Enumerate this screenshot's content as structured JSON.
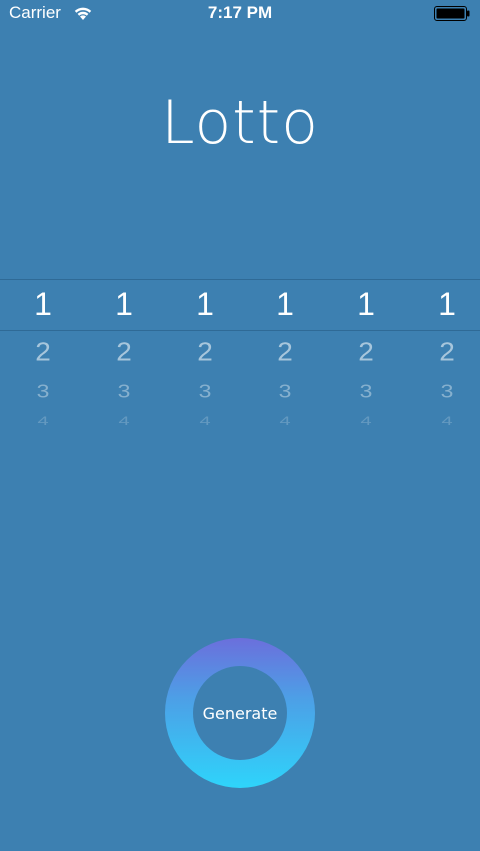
{
  "status_bar": {
    "carrier": "Carrier",
    "time": "7:17 PM",
    "wifi_icon": "wifi-icon",
    "battery_icon": "battery-icon"
  },
  "title": "Lotto",
  "picker": {
    "wheels": [
      {
        "values": [
          "1",
          "2",
          "3",
          "4"
        ]
      },
      {
        "values": [
          "1",
          "2",
          "3",
          "4"
        ]
      },
      {
        "values": [
          "1",
          "2",
          "3",
          "4"
        ]
      },
      {
        "values": [
          "1",
          "2",
          "3",
          "4"
        ]
      },
      {
        "values": [
          "1",
          "2",
          "3",
          "4"
        ]
      },
      {
        "values": [
          "1",
          "2",
          "3",
          "4"
        ]
      }
    ]
  },
  "generate_button": {
    "label": "Generate",
    "gradient_top": "#6b6fdc",
    "gradient_bottom": "#2ed4fb"
  },
  "colors": {
    "background": "#3d80b1",
    "text": "#ffffff"
  }
}
